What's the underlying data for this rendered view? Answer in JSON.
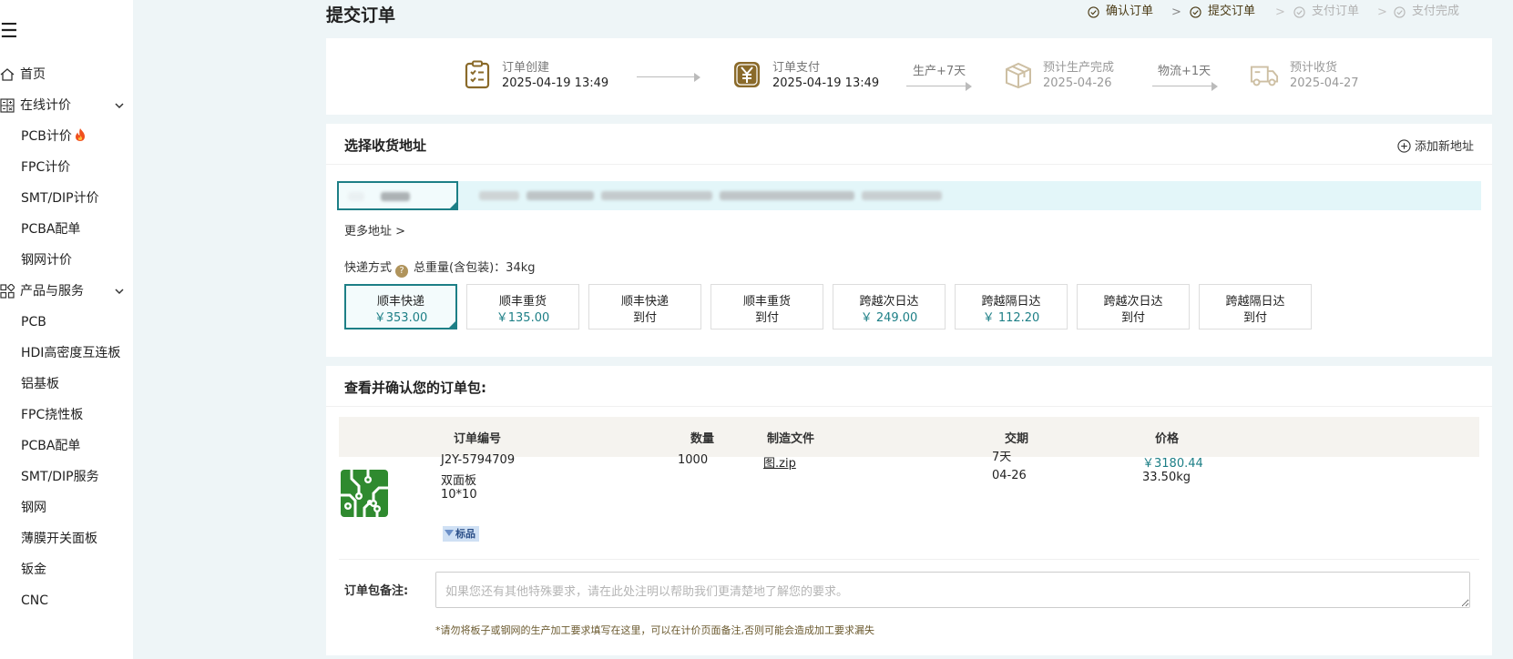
{
  "sidebar": {
    "menu_icon": "☰",
    "items": [
      {
        "label": "首页",
        "icon": "home-icon"
      },
      {
        "label": "在线计价",
        "icon": "calculator-icon",
        "expandable": true
      },
      {
        "label": "PCB计价",
        "hot": true
      },
      {
        "label": "FPC计价"
      },
      {
        "label": "SMT/DIP计价"
      },
      {
        "label": "PCBA配单"
      },
      {
        "label": "钢网计价"
      },
      {
        "label": "产品与服务",
        "icon": "grid-icon",
        "expandable": true
      },
      {
        "label": "PCB"
      },
      {
        "label": "HDI高密度互连板"
      },
      {
        "label": "铝基板"
      },
      {
        "label": "FPC挠性板"
      },
      {
        "label": "PCBA配单"
      },
      {
        "label": "SMT/DIP服务"
      },
      {
        "label": "钢网"
      },
      {
        "label": "薄膜开关面板"
      },
      {
        "label": "钣金"
      },
      {
        "label": "CNC"
      }
    ]
  },
  "page": {
    "title": "提交订单"
  },
  "steps": [
    {
      "label": "确认订单",
      "done": true
    },
    {
      "label": "提交订单",
      "done": true
    },
    {
      "label": "支付订单",
      "done": false
    },
    {
      "label": "支付完成",
      "done": false
    }
  ],
  "progress": {
    "items": [
      {
        "label": "订单创建",
        "date": "2025-04-19 13:49",
        "icon": "checklist-icon",
        "active": true
      },
      {
        "label": "订单支付",
        "date": "2025-04-19 13:49",
        "icon": "yen-icon",
        "active": true
      },
      {
        "label": "预计生产完成",
        "date": "2025-04-26",
        "icon": "box-icon",
        "active": false
      },
      {
        "label": "预计收货",
        "date": "2025-04-27",
        "icon": "truck-icon",
        "active": false
      }
    ],
    "arrows": [
      "",
      "生产+7天",
      "物流+1天"
    ]
  },
  "address": {
    "title": "选择收货地址",
    "add_label": "添加新地址",
    "more_label": "更多地址 >"
  },
  "shipping": {
    "label": "快递方式",
    "weight_label": "总重量(含包装)：",
    "weight_value": "34kg",
    "options": [
      {
        "name": "顺丰快递",
        "detail": "￥353.00",
        "selected": true,
        "price": true
      },
      {
        "name": "顺丰重货",
        "detail": "￥135.00",
        "selected": false,
        "price": true
      },
      {
        "name": "顺丰快递",
        "detail": "到付",
        "selected": false,
        "price": false
      },
      {
        "name": "顺丰重货",
        "detail": "到付",
        "selected": false,
        "price": false
      },
      {
        "name": "跨越次日达",
        "detail": "￥ 249.00",
        "selected": false,
        "price": true
      },
      {
        "name": "跨越隔日达",
        "detail": "￥ 112.20",
        "selected": false,
        "price": true
      },
      {
        "name": "跨越次日达",
        "detail": "到付",
        "selected": false,
        "price": false
      },
      {
        "name": "跨越隔日达",
        "detail": "到付",
        "selected": false,
        "price": false
      }
    ]
  },
  "order": {
    "title": "查看并确认您的订单包:",
    "columns": [
      "订单编号",
      "数量",
      "制造文件",
      "交期",
      "价格"
    ],
    "row": {
      "order_no": "J2Y-5794709",
      "board_type": "双面板",
      "size": "10*10",
      "tag": "标品",
      "quantity": "1000",
      "file": "图.zip",
      "lead_time": "7天",
      "lead_date": "04-26",
      "price": "￥3180.44",
      "weight": "33.50kg"
    },
    "remark_label": "订单包备注:",
    "remark_placeholder": "如果您还有其他特殊要求，请在此处注明以帮助我们更清楚地了解您的要求。",
    "remark_note": "*请勿将板子或钢网的生产加工要求填写在这里，可以在计价页面备注,否则可能会造成加工要求漏失"
  },
  "colors": {
    "accent": "#1d7f86",
    "brand_gold": "#8a6a2a",
    "pcb_green": "#2f8a2f"
  }
}
